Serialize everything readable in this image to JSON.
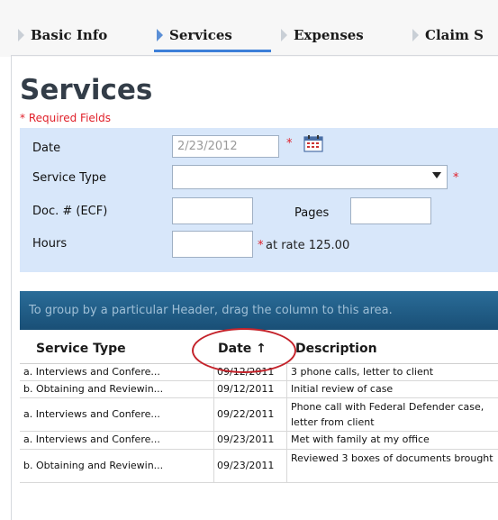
{
  "tabs": [
    {
      "label": "Basic Info",
      "active": false
    },
    {
      "label": "Services",
      "active": true
    },
    {
      "label": "Expenses",
      "active": false
    },
    {
      "label": "Claim S",
      "active": false
    }
  ],
  "page": {
    "title": "Services",
    "required_note": "* Required Fields"
  },
  "form": {
    "date_label": "Date",
    "date_value": "2/23/2012",
    "service_type_label": "Service Type",
    "service_type_value": "",
    "doc_label": "Doc. # (ECF)",
    "doc_value": "",
    "pages_label": "Pages",
    "pages_value": "",
    "hours_label": "Hours",
    "hours_value": "",
    "required_marker": "*",
    "rate_text": "at rate 125.00"
  },
  "grid": {
    "group_hint": "To group by a particular Header, drag the column to this area.",
    "columns": [
      "Service Type",
      "Date",
      "Description"
    ],
    "sort_indicator": "↑",
    "rows": [
      {
        "service_type": "a. Interviews and Confere...",
        "date": "09/12/2011",
        "description": "3 phone calls, letter to client"
      },
      {
        "service_type": "b. Obtaining and Reviewin...",
        "date": "09/12/2011",
        "description": "Initial review of case"
      },
      {
        "service_type": "a. Interviews and Confere...",
        "date": "09/22/2011",
        "description": "Phone call with Federal Defender case, letter from client"
      },
      {
        "service_type": "a. Interviews and Confere...",
        "date": "09/23/2011",
        "description": "Met with family at my office"
      },
      {
        "service_type": "b. Obtaining and Reviewin...",
        "date": "09/23/2011",
        "description": "Reviewed 3 boxes of documents brought"
      }
    ]
  },
  "colors": {
    "accent": "#3d7fd8",
    "required": "#e0202a",
    "form_bg": "#d8e7fa",
    "grid_header_bg": "#1f5c86",
    "highlight": "#c4232b"
  },
  "icons": {
    "tab_arrow": "triangle-right-icon",
    "calendar": "calendar-icon",
    "dropdown": "chevron-down-icon"
  }
}
